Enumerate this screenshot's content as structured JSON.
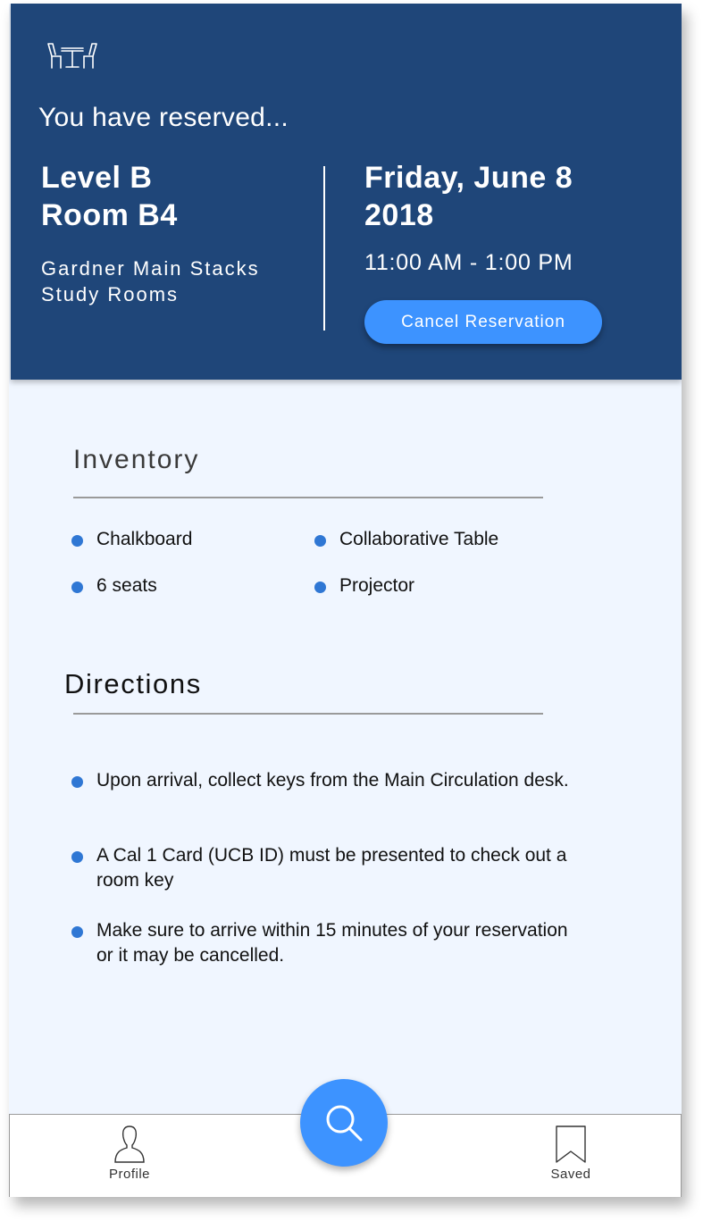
{
  "header": {
    "intro": "You have reserved...",
    "room_line1": "Level B",
    "room_line2": "Room B4",
    "building_line1": "Gardner Main Stacks",
    "building_line2": "Study Rooms",
    "date_line1": "Friday, June 8",
    "date_line2": "2018",
    "time": "11:00 AM - 1:00 PM",
    "cancel_label": "Cancel Reservation"
  },
  "inventory": {
    "title": "Inventory",
    "items": [
      "Chalkboard",
      "Collaborative Table",
      "6 seats",
      "Projector"
    ]
  },
  "directions": {
    "title": "Directions",
    "items": [
      "Upon arrival, collect keys from the Main Circulation desk.",
      "A Cal 1 Card (UCB ID) must be presented to check out a room key",
      "Make sure to arrive within 15 minutes of your reservation or it may be cancelled."
    ]
  },
  "tabbar": {
    "profile_label": "Profile",
    "saved_label": "Saved"
  },
  "colors": {
    "header_bg": "#1f4679",
    "accent": "#3d93ff",
    "bullet": "#2f77d4",
    "content_bg": "#f0f6ff"
  },
  "icons": {
    "app": "table-chairs-icon",
    "search": "search-icon",
    "profile": "person-icon",
    "saved": "bookmark-icon"
  }
}
